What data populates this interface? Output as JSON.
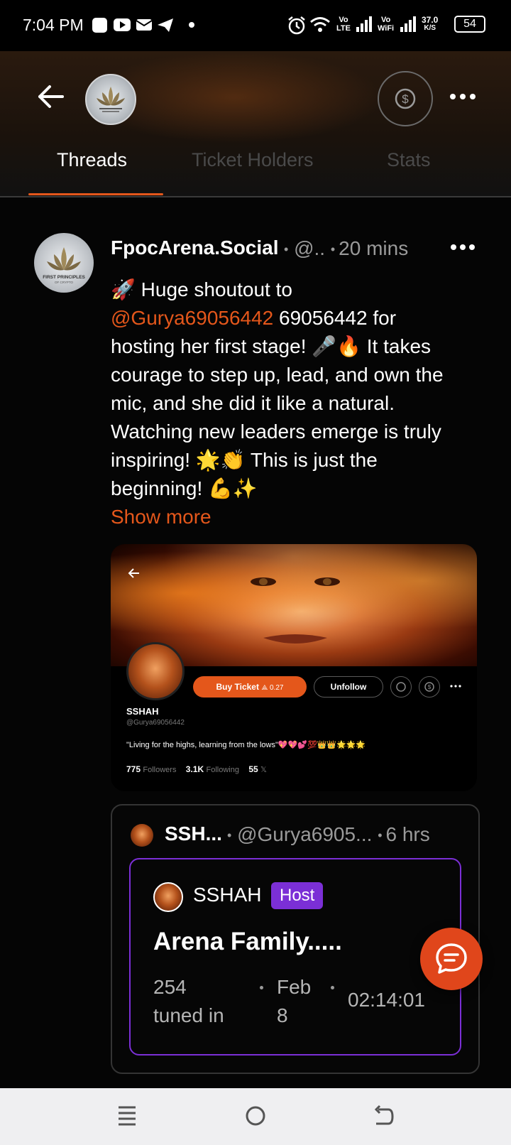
{
  "status_bar": {
    "time": "7:04 PM",
    "net_speed": "37.0",
    "net_unit": "K/S",
    "battery": "54",
    "lte_top": "Vo",
    "lte_bottom": "LTE",
    "wifi_top": "Vo",
    "wifi_bottom": "WiFi"
  },
  "tabs": [
    {
      "label": "Threads",
      "active": true
    },
    {
      "label": "Ticket Holders",
      "active": false
    },
    {
      "label": "Stats",
      "active": false
    }
  ],
  "post": {
    "author": "FpocArena.Social",
    "handle": "@..",
    "time": "20 mins",
    "text_line1_icon": "rocket-emoji",
    "text_part1": " Huge shoutout to",
    "mention": "@Gurya69056442",
    "text_part2": " 69056442 for",
    "text_line3": "hosting her first stage! 🎤🔥 It takes",
    "text_line4": "courage to step up, lead, and own the",
    "text_line5": "mic, and she did it like a natural.",
    "text_line6": "Watching new leaders emerge is truly",
    "text_line7": "inspiring! 🌟👏 This is just the",
    "text_line8": "beginning! 💪✨",
    "show_more": "Show more"
  },
  "embedded_card": {
    "buy_label": "Buy Ticket",
    "buy_price": "0.27",
    "unfollow_label": "Unfollow",
    "name": "SSHAH",
    "handle": "@Gurya69056442",
    "bio": "\"Living for the highs, learning from the lows\"💖💖💕💯👑👑🌟🌟🌟",
    "followers_count": "775",
    "followers_label": "Followers",
    "following_count": "3.1K",
    "following_label": "Following",
    "x_count": "55",
    "x_label": "𝕏"
  },
  "quoted": {
    "name": "SSH...",
    "handle": "@Gurya6905...",
    "time": "6 hrs",
    "host_name": "SSHAH",
    "host_badge": "Host",
    "title": "Arena Family.....",
    "tuned_count": "254",
    "tuned_label": "tuned in",
    "date_month": "Feb",
    "date_day": "8",
    "duration": "02:14:01"
  },
  "colors": {
    "accent": "#e4571b",
    "host_purple": "#7b2fd6",
    "background": "#050505"
  }
}
